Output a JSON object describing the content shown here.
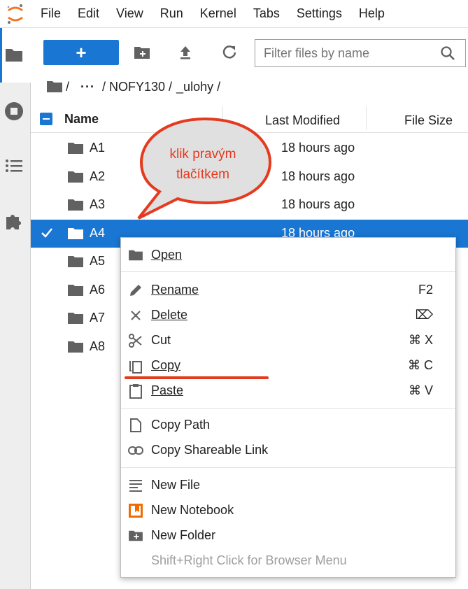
{
  "menubar": {
    "items": [
      "File",
      "Edit",
      "View",
      "Run",
      "Kernel",
      "Tabs",
      "Settings",
      "Help"
    ]
  },
  "toolbar": {
    "new_label": "+",
    "filter_placeholder": "Filter files by name"
  },
  "breadcrumb": {
    "parts": [
      "/",
      "···",
      "/ NOFY130 /",
      "_ulohy /"
    ]
  },
  "filelist": {
    "header": {
      "name": "Name",
      "modified": "Last Modified",
      "size": "File Size"
    },
    "rows": [
      {
        "name": "A1",
        "modified": "18 hours ago",
        "selected": false
      },
      {
        "name": "A2",
        "modified": "18 hours ago",
        "selected": false
      },
      {
        "name": "A3",
        "modified": "18 hours ago",
        "selected": false
      },
      {
        "name": "A4",
        "modified": "18 hours ago",
        "selected": true
      },
      {
        "name": "A5",
        "modified": "",
        "selected": false
      },
      {
        "name": "A6",
        "modified": "",
        "selected": false
      },
      {
        "name": "A7",
        "modified": "",
        "selected": false
      },
      {
        "name": "A8",
        "modified": "",
        "selected": false
      }
    ]
  },
  "callout": {
    "line1": "klik pravým",
    "line2": "tlačítkem",
    "color": "#e53a1e"
  },
  "context_menu": {
    "open": {
      "label": "Open",
      "icon": "folder-icon"
    },
    "rename": {
      "label": "Rename",
      "key": "F2",
      "icon": "pencil-icon"
    },
    "delete": {
      "label": "Delete",
      "key": "⌦",
      "icon": "close-icon"
    },
    "cut": {
      "label": "Cut",
      "key": "⌘ X",
      "icon": "scissors-icon"
    },
    "copy": {
      "label": "Copy",
      "key": "⌘ C",
      "icon": "copy-icon"
    },
    "paste": {
      "label": "Paste",
      "key": "⌘ V",
      "icon": "clipboard-icon"
    },
    "copy_path": {
      "label": "Copy Path",
      "icon": "file-icon"
    },
    "copy_link": {
      "label": "Copy Shareable Link",
      "icon": "link-icon"
    },
    "new_file": {
      "label": "New File",
      "icon": "text-file-icon"
    },
    "new_notebook": {
      "label": "New Notebook",
      "icon": "notebook-icon"
    },
    "new_folder": {
      "label": "New Folder",
      "icon": "new-folder-icon"
    },
    "hint": "Shift+Right Click for Browser Menu"
  },
  "colors": {
    "accent": "#1976d2",
    "annotation": "#e53a1e"
  }
}
